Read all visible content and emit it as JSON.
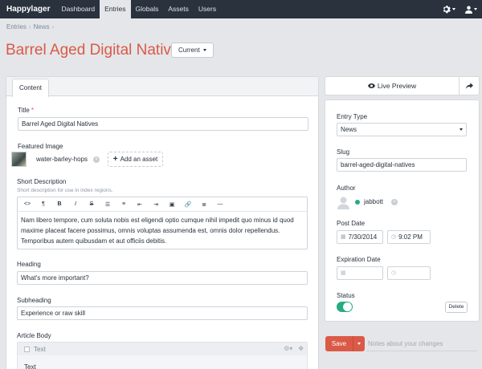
{
  "nav": {
    "brand": "Happylager",
    "items": [
      "Dashboard",
      "Entries",
      "Globals",
      "Assets",
      "Users"
    ],
    "active": "Entries"
  },
  "breadcrumb": [
    "Entries",
    "News"
  ],
  "breadcrumb_sep": "›",
  "page": {
    "title": "Barrel Aged Digital Natives",
    "status_label": "Current"
  },
  "tabs": [
    "Content"
  ],
  "fields": {
    "title_label": "Title",
    "title_required": "*",
    "title_value": "Barrel Aged Digital Natives",
    "featured_label": "Featured Image",
    "featured_asset": "water-barley-hops",
    "add_asset_label": "Add an asset",
    "short_desc_label": "Short Description",
    "short_desc_hint": "Short description for use in index regions.",
    "short_desc_text": "Nam libero tempore, cum soluta nobis est eligendi optio cumque nihil impedit quo minus id quod maxime placeat facere possimus, omnis voluptas assumenda est, omnis dolor repellendus. Temporibus autem quibusdam et aut officiis debitis.",
    "heading_label": "Heading",
    "heading_value": "What's more important?",
    "subheading_label": "Subheading",
    "subheading_value": "Experience or raw skill",
    "body_label": "Article Body",
    "block_type": "Text",
    "block_text": "Text"
  },
  "toolbar": [
    "<>",
    "¶",
    "B",
    "I",
    "S",
    "☰",
    "≡",
    "⇤",
    "⇥",
    "▣",
    "🔗",
    "≣",
    "—"
  ],
  "sidebar": {
    "live_preview": "Live Preview",
    "entry_type_label": "Entry Type",
    "entry_type_value": "News",
    "slug_label": "Slug",
    "slug_value": "barrel-aged-digital-natives",
    "author_label": "Author",
    "author_name": "jabbott",
    "post_date_label": "Post Date",
    "post_date": "7/30/2014",
    "post_time": "9:02 PM",
    "expiration_label": "Expiration Date",
    "status_label": "Status",
    "status_enabled": true,
    "delete_label": "Delete"
  },
  "actions": {
    "save": "Save",
    "notes_placeholder": "Notes about your changes"
  },
  "colors": {
    "accent": "#da5a47",
    "nav_bg": "#29323d",
    "enabled": "#27ab83"
  }
}
